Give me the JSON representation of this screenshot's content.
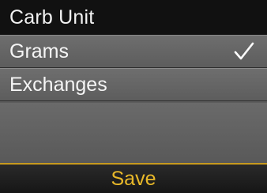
{
  "title_bar": {
    "title": "Carb Unit"
  },
  "options": [
    {
      "label": "Grams",
      "selected": true,
      "icon": "check-icon"
    },
    {
      "label": "Exchanges",
      "selected": false
    }
  ],
  "footer": {
    "save_label": "Save"
  },
  "colors": {
    "background": "#5c5c5c",
    "title_background": "#111111",
    "text": "#ffffff",
    "accent": "#e8b829",
    "footer_background": "#1e1e1e"
  }
}
